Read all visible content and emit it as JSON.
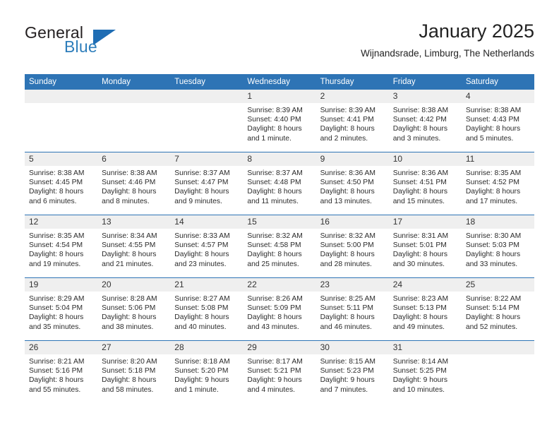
{
  "logo": {
    "general": "General",
    "blue": "Blue",
    "triangle_color": "#1f6db4"
  },
  "header": {
    "month_title": "January 2025",
    "location": "Wijnandsrade, Limburg, The Netherlands"
  },
  "theme": {
    "header_blue": "#2e74b5",
    "daynum_gray": "#efefef",
    "text": "#2b2b2b"
  },
  "weekday_headers": [
    "Sunday",
    "Monday",
    "Tuesday",
    "Wednesday",
    "Thursday",
    "Friday",
    "Saturday"
  ],
  "weeks": [
    [
      {
        "day": "",
        "sunrise": "",
        "sunset": "",
        "daylight_line1": "",
        "daylight_line2": ""
      },
      {
        "day": "",
        "sunrise": "",
        "sunset": "",
        "daylight_line1": "",
        "daylight_line2": ""
      },
      {
        "day": "",
        "sunrise": "",
        "sunset": "",
        "daylight_line1": "",
        "daylight_line2": ""
      },
      {
        "day": "1",
        "sunrise": "Sunrise: 8:39 AM",
        "sunset": "Sunset: 4:40 PM",
        "daylight_line1": "Daylight: 8 hours",
        "daylight_line2": "and 1 minute."
      },
      {
        "day": "2",
        "sunrise": "Sunrise: 8:39 AM",
        "sunset": "Sunset: 4:41 PM",
        "daylight_line1": "Daylight: 8 hours",
        "daylight_line2": "and 2 minutes."
      },
      {
        "day": "3",
        "sunrise": "Sunrise: 8:38 AM",
        "sunset": "Sunset: 4:42 PM",
        "daylight_line1": "Daylight: 8 hours",
        "daylight_line2": "and 3 minutes."
      },
      {
        "day": "4",
        "sunrise": "Sunrise: 8:38 AM",
        "sunset": "Sunset: 4:43 PM",
        "daylight_line1": "Daylight: 8 hours",
        "daylight_line2": "and 5 minutes."
      }
    ],
    [
      {
        "day": "5",
        "sunrise": "Sunrise: 8:38 AM",
        "sunset": "Sunset: 4:45 PM",
        "daylight_line1": "Daylight: 8 hours",
        "daylight_line2": "and 6 minutes."
      },
      {
        "day": "6",
        "sunrise": "Sunrise: 8:38 AM",
        "sunset": "Sunset: 4:46 PM",
        "daylight_line1": "Daylight: 8 hours",
        "daylight_line2": "and 8 minutes."
      },
      {
        "day": "7",
        "sunrise": "Sunrise: 8:37 AM",
        "sunset": "Sunset: 4:47 PM",
        "daylight_line1": "Daylight: 8 hours",
        "daylight_line2": "and 9 minutes."
      },
      {
        "day": "8",
        "sunrise": "Sunrise: 8:37 AM",
        "sunset": "Sunset: 4:48 PM",
        "daylight_line1": "Daylight: 8 hours",
        "daylight_line2": "and 11 minutes."
      },
      {
        "day": "9",
        "sunrise": "Sunrise: 8:36 AM",
        "sunset": "Sunset: 4:50 PM",
        "daylight_line1": "Daylight: 8 hours",
        "daylight_line2": "and 13 minutes."
      },
      {
        "day": "10",
        "sunrise": "Sunrise: 8:36 AM",
        "sunset": "Sunset: 4:51 PM",
        "daylight_line1": "Daylight: 8 hours",
        "daylight_line2": "and 15 minutes."
      },
      {
        "day": "11",
        "sunrise": "Sunrise: 8:35 AM",
        "sunset": "Sunset: 4:52 PM",
        "daylight_line1": "Daylight: 8 hours",
        "daylight_line2": "and 17 minutes."
      }
    ],
    [
      {
        "day": "12",
        "sunrise": "Sunrise: 8:35 AM",
        "sunset": "Sunset: 4:54 PM",
        "daylight_line1": "Daylight: 8 hours",
        "daylight_line2": "and 19 minutes."
      },
      {
        "day": "13",
        "sunrise": "Sunrise: 8:34 AM",
        "sunset": "Sunset: 4:55 PM",
        "daylight_line1": "Daylight: 8 hours",
        "daylight_line2": "and 21 minutes."
      },
      {
        "day": "14",
        "sunrise": "Sunrise: 8:33 AM",
        "sunset": "Sunset: 4:57 PM",
        "daylight_line1": "Daylight: 8 hours",
        "daylight_line2": "and 23 minutes."
      },
      {
        "day": "15",
        "sunrise": "Sunrise: 8:32 AM",
        "sunset": "Sunset: 4:58 PM",
        "daylight_line1": "Daylight: 8 hours",
        "daylight_line2": "and 25 minutes."
      },
      {
        "day": "16",
        "sunrise": "Sunrise: 8:32 AM",
        "sunset": "Sunset: 5:00 PM",
        "daylight_line1": "Daylight: 8 hours",
        "daylight_line2": "and 28 minutes."
      },
      {
        "day": "17",
        "sunrise": "Sunrise: 8:31 AM",
        "sunset": "Sunset: 5:01 PM",
        "daylight_line1": "Daylight: 8 hours",
        "daylight_line2": "and 30 minutes."
      },
      {
        "day": "18",
        "sunrise": "Sunrise: 8:30 AM",
        "sunset": "Sunset: 5:03 PM",
        "daylight_line1": "Daylight: 8 hours",
        "daylight_line2": "and 33 minutes."
      }
    ],
    [
      {
        "day": "19",
        "sunrise": "Sunrise: 8:29 AM",
        "sunset": "Sunset: 5:04 PM",
        "daylight_line1": "Daylight: 8 hours",
        "daylight_line2": "and 35 minutes."
      },
      {
        "day": "20",
        "sunrise": "Sunrise: 8:28 AM",
        "sunset": "Sunset: 5:06 PM",
        "daylight_line1": "Daylight: 8 hours",
        "daylight_line2": "and 38 minutes."
      },
      {
        "day": "21",
        "sunrise": "Sunrise: 8:27 AM",
        "sunset": "Sunset: 5:08 PM",
        "daylight_line1": "Daylight: 8 hours",
        "daylight_line2": "and 40 minutes."
      },
      {
        "day": "22",
        "sunrise": "Sunrise: 8:26 AM",
        "sunset": "Sunset: 5:09 PM",
        "daylight_line1": "Daylight: 8 hours",
        "daylight_line2": "and 43 minutes."
      },
      {
        "day": "23",
        "sunrise": "Sunrise: 8:25 AM",
        "sunset": "Sunset: 5:11 PM",
        "daylight_line1": "Daylight: 8 hours",
        "daylight_line2": "and 46 minutes."
      },
      {
        "day": "24",
        "sunrise": "Sunrise: 8:23 AM",
        "sunset": "Sunset: 5:13 PM",
        "daylight_line1": "Daylight: 8 hours",
        "daylight_line2": "and 49 minutes."
      },
      {
        "day": "25",
        "sunrise": "Sunrise: 8:22 AM",
        "sunset": "Sunset: 5:14 PM",
        "daylight_line1": "Daylight: 8 hours",
        "daylight_line2": "and 52 minutes."
      }
    ],
    [
      {
        "day": "26",
        "sunrise": "Sunrise: 8:21 AM",
        "sunset": "Sunset: 5:16 PM",
        "daylight_line1": "Daylight: 8 hours",
        "daylight_line2": "and 55 minutes."
      },
      {
        "day": "27",
        "sunrise": "Sunrise: 8:20 AM",
        "sunset": "Sunset: 5:18 PM",
        "daylight_line1": "Daylight: 8 hours",
        "daylight_line2": "and 58 minutes."
      },
      {
        "day": "28",
        "sunrise": "Sunrise: 8:18 AM",
        "sunset": "Sunset: 5:20 PM",
        "daylight_line1": "Daylight: 9 hours",
        "daylight_line2": "and 1 minute."
      },
      {
        "day": "29",
        "sunrise": "Sunrise: 8:17 AM",
        "sunset": "Sunset: 5:21 PM",
        "daylight_line1": "Daylight: 9 hours",
        "daylight_line2": "and 4 minutes."
      },
      {
        "day": "30",
        "sunrise": "Sunrise: 8:15 AM",
        "sunset": "Sunset: 5:23 PM",
        "daylight_line1": "Daylight: 9 hours",
        "daylight_line2": "and 7 minutes."
      },
      {
        "day": "31",
        "sunrise": "Sunrise: 8:14 AM",
        "sunset": "Sunset: 5:25 PM",
        "daylight_line1": "Daylight: 9 hours",
        "daylight_line2": "and 10 minutes."
      },
      {
        "day": "",
        "sunrise": "",
        "sunset": "",
        "daylight_line1": "",
        "daylight_line2": ""
      }
    ]
  ]
}
